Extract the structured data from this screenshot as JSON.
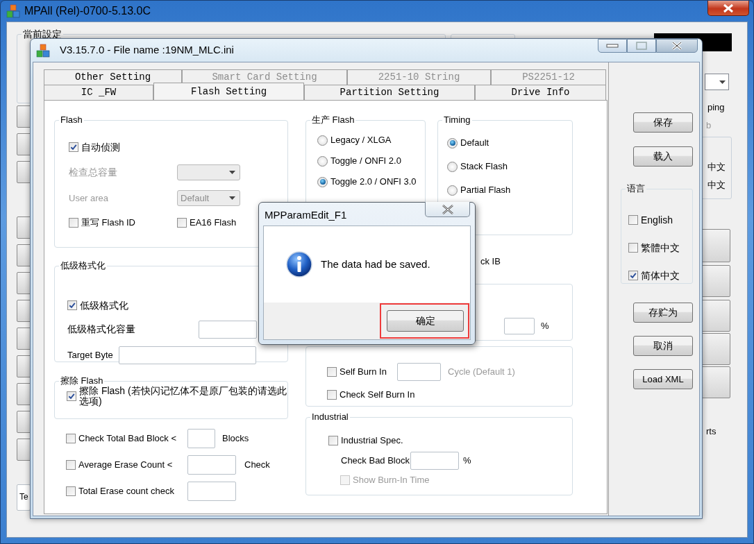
{
  "outer_window": {
    "title": "MPAll (Rel)-0700-5.13.0C",
    "current_settings_label": "當前設定",
    "right_texts": [
      "ping",
      "b",
      "中文",
      "中文"
    ],
    "right_lower_text": "rts",
    "left_field_text": "Te"
  },
  "settings_window": {
    "title": "V3.15.7.0 - File name :19NM_MLC.ini",
    "tab_rows": [
      [
        {
          "label": "Other Setting",
          "selected": false,
          "disabled": false
        },
        {
          "label": "Smart Card Setting",
          "selected": false,
          "disabled": true
        },
        {
          "label": "2251-10 String",
          "selected": false,
          "disabled": true
        },
        {
          "label": "PS2251-12",
          "selected": false,
          "disabled": true
        }
      ],
      [
        {
          "label": "IC _FW",
          "selected": false,
          "disabled": false
        },
        {
          "label": "Flash Setting",
          "selected": true,
          "disabled": false
        },
        {
          "label": "Partition Setting",
          "selected": false,
          "disabled": false
        },
        {
          "label": "Drive Info",
          "selected": false,
          "disabled": false
        }
      ]
    ]
  },
  "flash": {
    "title": "Flash",
    "auto_detect": {
      "label": "自动侦测",
      "checked": true
    },
    "capacity_check": {
      "label": "检查总容量",
      "disabled": true
    },
    "user_area": {
      "label": "User area",
      "value": "Default",
      "disabled": true
    },
    "rewrite_id": {
      "label": "重写 Flash ID",
      "checked": false
    },
    "ea16": {
      "label": "EA16 Flash",
      "checked": false
    }
  },
  "low_format": {
    "title": "低级格式化",
    "enable": {
      "label": "低级格式化",
      "checked": true
    },
    "capacity_label": "低级格式化容量",
    "target_byte_label": "Target Byte"
  },
  "erase": {
    "title": "擦除 Flash",
    "option": {
      "label": "擦除 Flash (若快闪记忆体不是原厂包装的请选此选项)",
      "checked": true
    }
  },
  "checks": [
    {
      "label": "Check Total Bad Block <",
      "checked": false,
      "unit": "Blocks"
    },
    {
      "label": "Average Erase Count <",
      "checked": false,
      "unit": "Check"
    },
    {
      "label": "Total Erase count check",
      "checked": false
    }
  ],
  "production_flash": {
    "title": "生产 Flash",
    "options": [
      {
        "label": "Legacy / XLGA",
        "selected": false
      },
      {
        "label": "Toggle / ONFI 2.0",
        "selected": false
      },
      {
        "label": "Toggle 2.0 / ONFI 3.0",
        "selected": true
      }
    ]
  },
  "timing": {
    "title": "Timing",
    "options": [
      {
        "label": "Default",
        "selected": true
      },
      {
        "label": "Stack Flash",
        "selected": false
      },
      {
        "label": "Partial Flash",
        "selected": false
      }
    ]
  },
  "block_text": "ck IB",
  "percent_unit": "%",
  "burn_in": {
    "self_burn_in": {
      "label": "Self Burn In",
      "checked": false
    },
    "cycle_hint": "Cycle (Default 1)",
    "check_self": {
      "label": "Check Self Burn In",
      "checked": false
    }
  },
  "industrial": {
    "title": "Industrial",
    "spec": {
      "label": "Industrial Spec.",
      "checked": false
    },
    "bad_block_label": "Check Bad Block",
    "bad_block_unit": "%",
    "show_time": {
      "label": "Show Burn-In Time",
      "checked": false,
      "disabled": true
    }
  },
  "side_buttons": {
    "top": [
      "保存",
      "载入"
    ],
    "bottom": [
      "存贮为",
      "取消",
      "Load XML"
    ]
  },
  "language": {
    "title": "语言",
    "options": [
      {
        "label": "English",
        "checked": false
      },
      {
        "label": "繁體中文",
        "checked": false
      },
      {
        "label": "简体中文",
        "checked": true
      }
    ]
  },
  "dialog": {
    "title": "MPParamEdit_F1",
    "message": "The data had be saved.",
    "ok_button": "确定",
    "highlighted": true
  }
}
